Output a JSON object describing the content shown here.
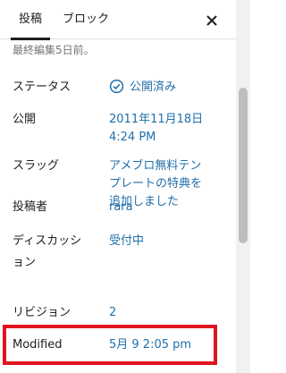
{
  "tabs": {
    "post": "投稿",
    "block": "ブロック",
    "close": "✕"
  },
  "edited_text": "最終編集5日前。",
  "fields": {
    "status": {
      "label": "ステータス",
      "value": "公開済み"
    },
    "published": {
      "label": "公開",
      "value_line1": "2011年11月18日",
      "value_line2": "4:24 PM"
    },
    "slug": {
      "label": "スラッグ",
      "value_line1": "アメブロ無料テン",
      "value_line2": "プレートの特典を",
      "value_line3": "追加しました"
    },
    "author": {
      "label": "投稿者",
      "value": "rara"
    },
    "discussion": {
      "label_line1": "ディスカッシ",
      "label_line2": "ョン",
      "value": "受付中"
    },
    "revisions": {
      "label": "リビジョン",
      "value": "2"
    },
    "modified": {
      "label": "Modified",
      "value": "5月 9 2:05 pm"
    }
  },
  "colors": {
    "link": "#1f6fab",
    "highlight": "#e0141e"
  },
  "icons": {
    "status": "check-circle-icon",
    "close": "close-icon"
  }
}
